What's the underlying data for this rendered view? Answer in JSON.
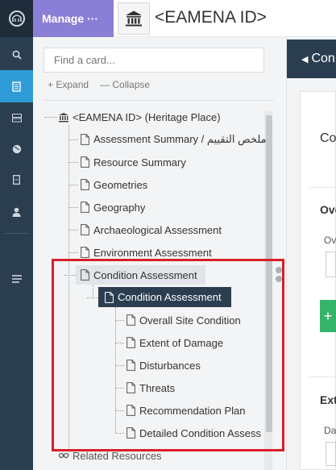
{
  "header": {
    "manage_label": "Manage",
    "manage_dots": "···",
    "resource_title": "<EAMENA ID>"
  },
  "search": {
    "placeholder": "Find a card..."
  },
  "tree_controls": {
    "expand_label": "+ Expand",
    "collapse_label": "— Collapse"
  },
  "tree": {
    "root": "<EAMENA ID> (Heritage Place)",
    "items": [
      "Assessment Summary / ملخص التقييم",
      "Resource Summary",
      "Geometries",
      "Geography",
      "Archaeological Assessment",
      "Environment Assessment"
    ],
    "condition_parent": "Condition Assessment",
    "condition_child": "Condition Assessment",
    "condition_subitems": [
      "Overall Site Condition",
      "Extent of Damage",
      "Disturbances",
      "Threats",
      "Recommendation Plan",
      "Detailed Condition Assess"
    ],
    "related": "Related Resources"
  },
  "right": {
    "bar_label": "Con",
    "card_heading": "Co",
    "section1": "Ove",
    "field1": "Ov",
    "section2": "Ext",
    "field2": "Da"
  },
  "colors": {
    "rail": "#2b3e50",
    "rail_active": "#2f9bd6",
    "manage": "#8a7fd6",
    "selected": "#2b3e50",
    "highlight": "#d81f2a",
    "green": "#35b36a"
  }
}
